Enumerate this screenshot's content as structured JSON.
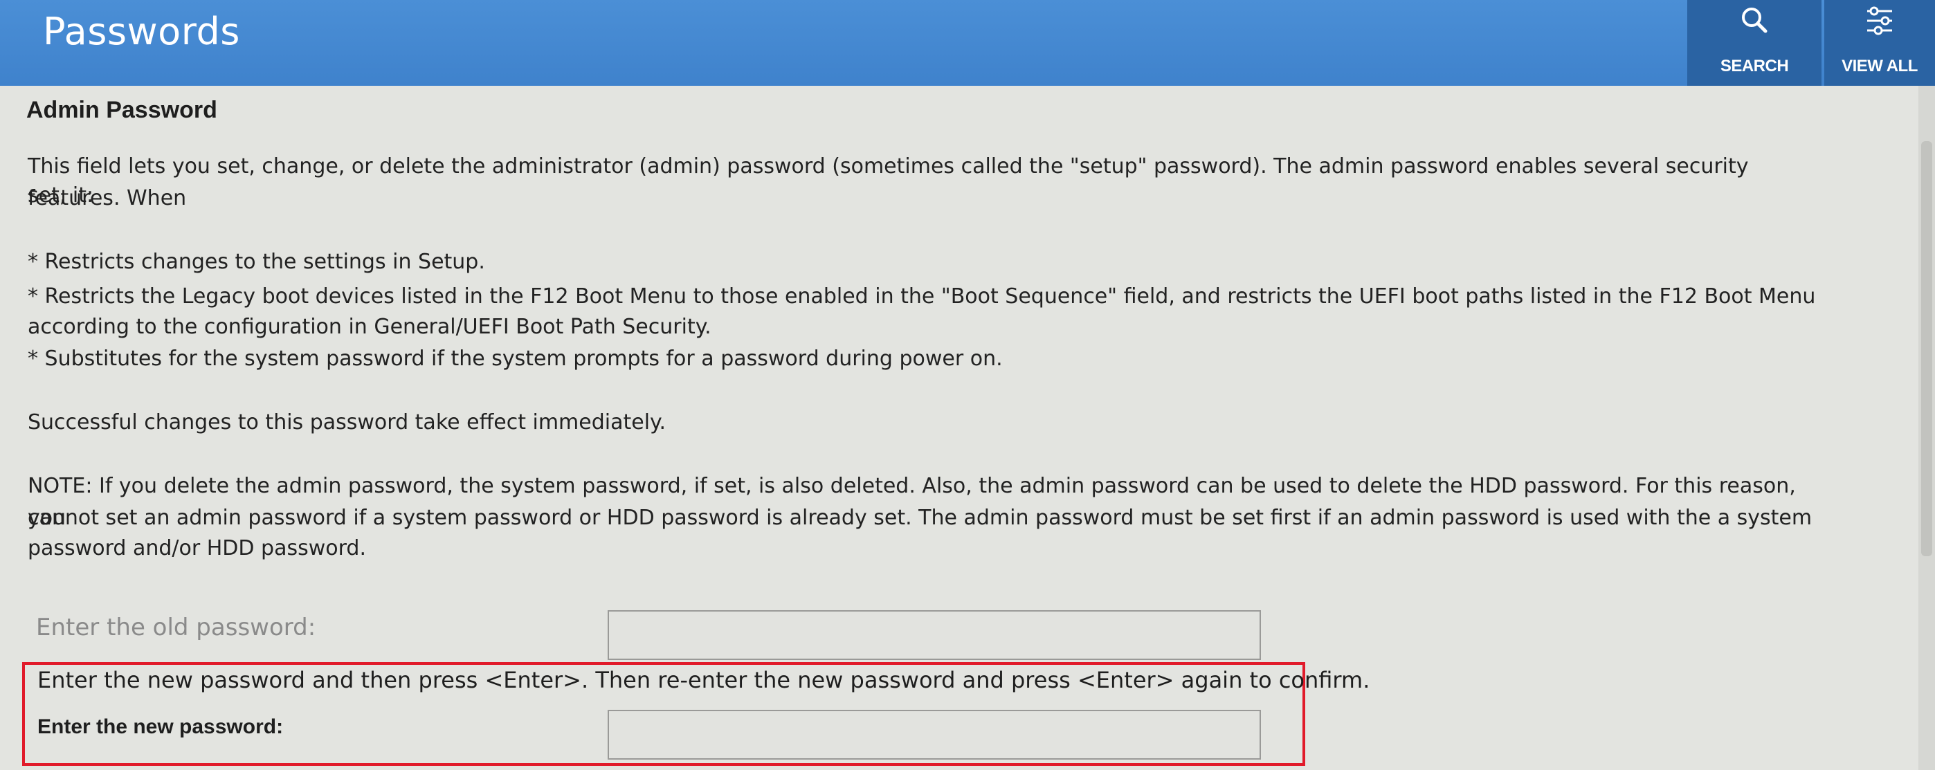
{
  "header": {
    "title": "Passwords",
    "search_label": "SEARCH",
    "viewall_label": "VIEW ALL",
    "search_icon": "search-icon",
    "viewall_icon": "sliders-icon"
  },
  "section": {
    "title": "Admin Password",
    "intro_line1": "This field lets you set, change, or delete the administrator (admin) password (sometimes called the \"setup\" password). The admin password enables several security features. When",
    "intro_line2": "set, it:",
    "bullet1": "* Restricts changes to the settings in Setup.",
    "bullet2_line1": "* Restricts the Legacy boot devices listed in the F12 Boot Menu to those enabled in the \"Boot Sequence\" field, and restricts the UEFI boot paths listed in the F12 Boot Menu",
    "bullet2_line2": "according to the configuration in General/UEFI Boot Path Security.",
    "bullet3": "* Substitutes for the system password if the system prompts for a password during power on.",
    "success_note": "Successful changes to this password take effect immediately.",
    "note_line1": "NOTE: If you delete the admin password, the system password, if set, is also deleted. Also, the admin password can be used to delete the HDD password. For this reason, you",
    "note_line2": "cannot set an admin password if a system password or HDD password is already set. The admin password must be set first if an admin password is used with the a system",
    "note_line3": "password and/or HDD password."
  },
  "form": {
    "old_password_label": "Enter the old password:",
    "old_password_value": "",
    "instruction": "Enter the new password and then press <Enter>. Then re-enter the new password and press <Enter> again to confirm.",
    "new_password_label": "Enter the new password:",
    "new_password_value": ""
  },
  "colors": {
    "header_blue": "#4189d2",
    "header_button_blue": "#2a63a3",
    "highlight_red": "#e11a2a",
    "background": "#e3e4e0"
  }
}
